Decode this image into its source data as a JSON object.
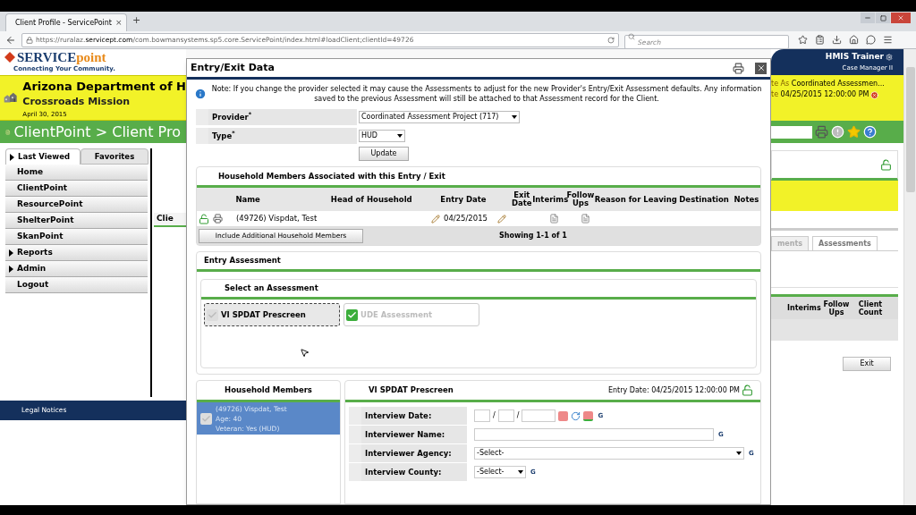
{
  "browser": {
    "tab_title": "Client Profile - ServicePoint",
    "tab_close": "×",
    "new_tab": "+",
    "url_host": "https://ruralaz.",
    "url_domain": "servicept.com",
    "url_path": "/com.bowmansystems.sp5.core.ServicePoint/index.html#loadClient;clientId=49726",
    "search_placeholder": "Search"
  },
  "header": {
    "logo_left": "SERVICE",
    "logo_right": "point",
    "tagline": "Connecting Your Community.",
    "agency": "Arizona Department of H",
    "provider": "Crossroads Mission",
    "date": "April 30, 2015",
    "breadcrumb": "ClientPoint > Client Pro"
  },
  "nav": {
    "tabs": [
      {
        "label": "Last Viewed",
        "selected": true
      },
      {
        "label": "Favorites",
        "selected": false
      }
    ],
    "items": [
      {
        "label": "Home",
        "expandable": false
      },
      {
        "label": "ClientPoint",
        "expandable": false
      },
      {
        "label": "ResourcePoint",
        "expandable": false
      },
      {
        "label": "ShelterPoint",
        "expandable": false
      },
      {
        "label": "SkanPoint",
        "expandable": false
      },
      {
        "label": "Reports",
        "expandable": true
      },
      {
        "label": "Admin",
        "expandable": true
      },
      {
        "label": "Logout",
        "expandable": false
      }
    ]
  },
  "legal_notices": "Legal Notices",
  "background_tab": "Clie",
  "user": {
    "name": "HMIS Trainer",
    "role": "Case Manager II"
  },
  "client_banner": {
    "line_1_prefix": "te As",
    "line_1": "Coordinated Assessmen...",
    "line_2_prefix": "te",
    "line_2": "04/25/2015 12:00:00 PM"
  },
  "background_tabs": [
    {
      "label": "ments",
      "selected": false
    },
    {
      "label": "Assessments",
      "selected": true
    }
  ],
  "background_columns": [
    "Interims",
    "Follow Ups",
    "Client Count"
  ],
  "exit_button": "Exit",
  "modal": {
    "title": "Entry/Exit Data",
    "note": "Note: If you change the provider selected it may cause the Assessments to adjust for the new Provider's Entry/Exit Assessment defaults. Any information saved to the previous Assessment will still be attached to that Assessment record for the Client.",
    "fields": [
      {
        "label": "Provider",
        "required": true,
        "required_mark": "*",
        "value": "Coordinated Assessment Project (717)"
      },
      {
        "label": "Type",
        "required": true,
        "required_mark": "*",
        "value": "HUD"
      }
    ],
    "update_button": "Update",
    "household": {
      "title": "Household Members Associated with this Entry / Exit",
      "columns": [
        "Name",
        "Head of Household",
        "Entry Date",
        "Exit Date",
        "Interims",
        "Follow Ups",
        "Reason for Leaving",
        "Destination",
        "Notes"
      ],
      "rows": [
        {
          "name": "(49726) Vispdat, Test",
          "entry_date": "04/25/2015"
        }
      ],
      "include_button": "Include Additional Household Members",
      "showing": "Showing 1-1 of 1"
    },
    "entry_assessment": {
      "title": "Entry Assessment",
      "select_title": "Select an Assessment",
      "assessments": [
        {
          "label": "VI SPDAT Prescreen",
          "selected": true,
          "complete": false
        },
        {
          "label": "UDE Assessment",
          "selected": false,
          "complete": true
        }
      ]
    },
    "members": {
      "title": "Household Members",
      "items": [
        {
          "lines": [
            "(49726) Vispdat, Test",
            "Age: 40",
            "Veteran: Yes (HUD)"
          ],
          "selected": true
        }
      ]
    },
    "form": {
      "title": "VI SPDAT Prescreen",
      "entry_date": "Entry Date: 04/25/2015 12:00:00 PM",
      "fields": [
        {
          "label": "Interview Date:",
          "kind": "date",
          "date_sep": "/",
          "g": "G"
        },
        {
          "label": "Interviewer Name:",
          "kind": "text",
          "g": "G"
        },
        {
          "label": "Interviewer Agency:",
          "kind": "select",
          "value": "-Select-",
          "g": "G"
        },
        {
          "label": "Interview County:",
          "kind": "short_select",
          "value": "-Select-",
          "g": "G"
        }
      ]
    }
  }
}
